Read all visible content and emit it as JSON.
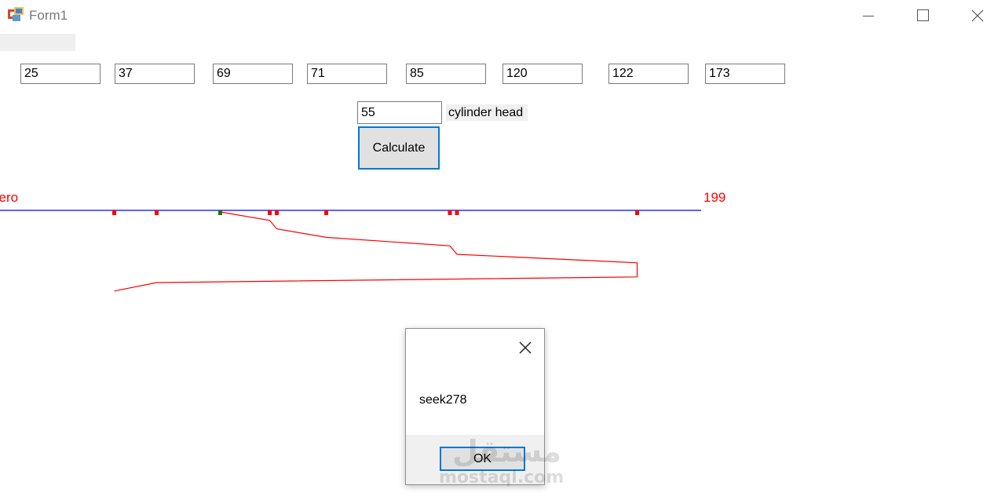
{
  "window": {
    "title": "Form1"
  },
  "inputs": {
    "requests": [
      "25",
      "37",
      "69",
      "71",
      "85",
      "120",
      "122",
      "173"
    ],
    "head": "55"
  },
  "labels": {
    "head": "cylinder head",
    "calculate": "Calculate"
  },
  "chart_data": {
    "type": "line",
    "start_label": "zero",
    "end_label": "199",
    "requests": [
      25,
      37,
      69,
      71,
      85,
      120,
      122,
      173
    ],
    "head": 55,
    "seek_order": [
      55,
      69,
      71,
      85,
      120,
      122,
      173,
      37,
      25
    ],
    "colors": {
      "axis": "#0000ff",
      "path": "#ff0000",
      "request_marker": "#ff0000",
      "head_marker": "#008000"
    }
  },
  "dialog": {
    "message": "seek278",
    "ok": "OK"
  },
  "watermark": {
    "arabic": "مستقل",
    "latin": "mostaql.com"
  }
}
